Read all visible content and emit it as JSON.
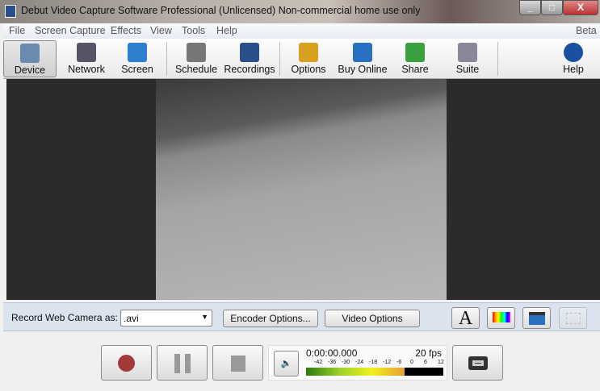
{
  "window": {
    "title": "Debut Video Capture Software Professional (Unlicensed) Non-commercial home use only",
    "minimize": "_",
    "maximize": "□",
    "close": "X"
  },
  "menu": {
    "items": [
      "File",
      "Screen Capture",
      "Effects",
      "View",
      "Tools",
      "Help"
    ],
    "right": "Beta"
  },
  "toolbar": {
    "items": [
      {
        "label": "Device",
        "icon": "webcam-icon",
        "color": "#6a8ab0"
      },
      {
        "label": "Network",
        "icon": "network-camera-icon",
        "color": "#556"
      },
      {
        "label": "Screen",
        "icon": "screen-icon",
        "color": "#2f7fd0"
      },
      {
        "label": "Schedule",
        "icon": "schedule-icon",
        "color": "#777"
      },
      {
        "label": "Recordings",
        "icon": "recordings-icon",
        "color": "#2a4f8a"
      },
      {
        "label": "Options",
        "icon": "options-tools-icon",
        "color": "#d9a020"
      },
      {
        "label": "Buy Online",
        "icon": "buy-online-globe-icon",
        "color": "#2a70c0"
      },
      {
        "label": "Share",
        "icon": "share-thumbs-up-icon",
        "color": "#3aa040"
      },
      {
        "label": "Suite",
        "icon": "suite-briefcase-icon",
        "color": "#889"
      },
      {
        "label": "Help",
        "icon": "help-icon",
        "color": "#1a50a0"
      }
    ]
  },
  "options": {
    "record_label": "Record Web Camera as:",
    "format": ".avi",
    "encoder": "Encoder Options...",
    "video": "Video Options"
  },
  "controls": {
    "time": "0:00:00.000",
    "fps": "20 fps",
    "scale": [
      "-42",
      "-36",
      "-30",
      "-24",
      "-18",
      "-12",
      "-6",
      "0",
      "6",
      "12"
    ],
    "level_fraction": 0.72
  }
}
